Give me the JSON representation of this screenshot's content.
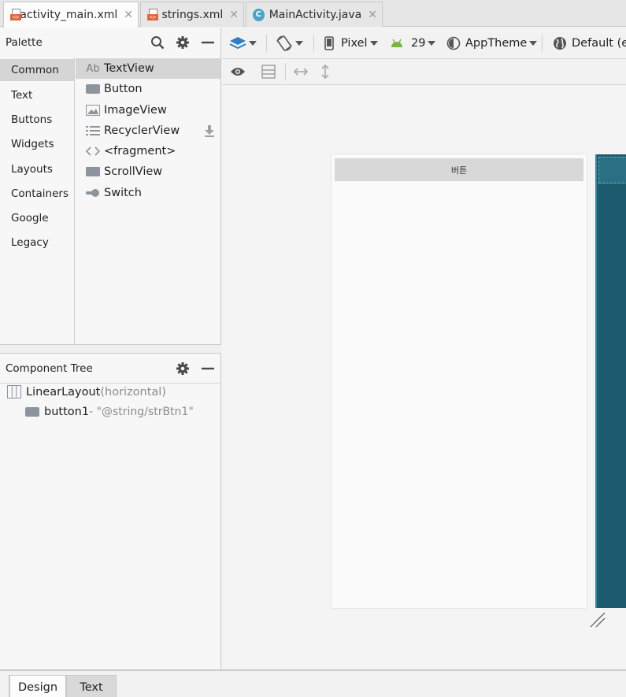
{
  "tabs": [
    {
      "label": "activity_main.xml",
      "icon": "xml-file-icon",
      "active": true
    },
    {
      "label": "strings.xml",
      "icon": "xml-file-icon",
      "active": false
    },
    {
      "label": "MainActivity.java",
      "icon": "java-class-icon",
      "active": false
    }
  ],
  "palette": {
    "title": "Palette",
    "categories": [
      "Common",
      "Text",
      "Buttons",
      "Widgets",
      "Layouts",
      "Containers",
      "Google",
      "Legacy"
    ],
    "selected_category": "Common",
    "items": [
      {
        "label": "TextView",
        "icon": "textview-icon"
      },
      {
        "label": "Button",
        "icon": "button-icon"
      },
      {
        "label": "ImageView",
        "icon": "imageview-icon"
      },
      {
        "label": "RecyclerView",
        "icon": "recyclerview-icon"
      },
      {
        "label": "<fragment>",
        "icon": "fragment-icon"
      },
      {
        "label": "ScrollView",
        "icon": "scrollview-icon"
      },
      {
        "label": "Switch",
        "icon": "switch-icon"
      }
    ],
    "textview_prefix": "Ab"
  },
  "component_tree": {
    "title": "Component Tree",
    "root": {
      "label": "LinearLayout",
      "detail": "(horizontal)"
    },
    "child": {
      "label": "button1",
      "detail": "- \"@string/strBtn1\""
    }
  },
  "toolbar": {
    "device": "Pixel",
    "api": "29",
    "theme": "AppTheme",
    "locale": "Default (e"
  },
  "canvas": {
    "button_text": "버튼"
  },
  "bottom_tabs": {
    "design": "Design",
    "text": "Text"
  },
  "colors": {
    "accent_xml": "#d9683a",
    "java": "#4aa3c8",
    "blueprint": "#1f5b6e",
    "android": "#7cb342"
  }
}
